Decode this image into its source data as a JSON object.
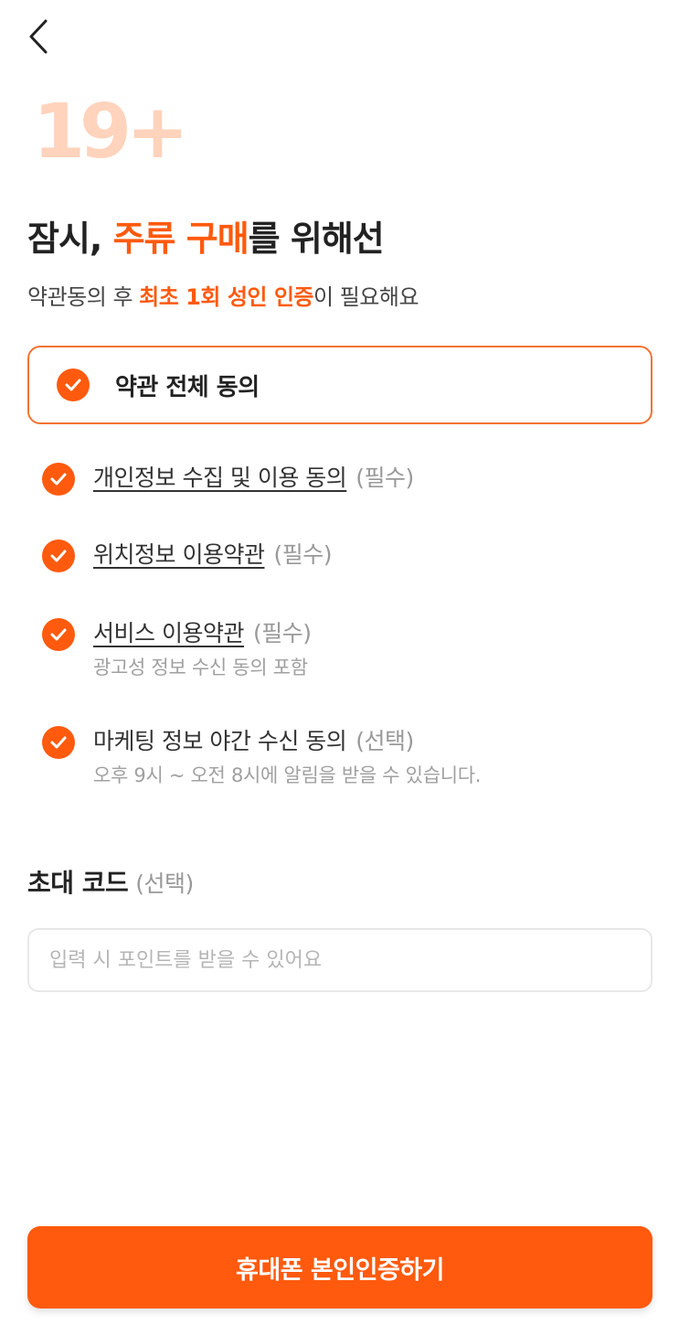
{
  "header": {
    "back_icon": "chevron-left-icon",
    "age_badge": "19+"
  },
  "title": {
    "part1": "잠시, ",
    "accent": "주류 구매",
    "part2": "를 위해선"
  },
  "subtitle": {
    "part1": "약관동의 후 ",
    "accent": "최초 1회 성인 인증",
    "part2": "이 필요해요"
  },
  "agree_all": {
    "label": "약관 전체 동의",
    "checked": true
  },
  "terms": [
    {
      "label": "개인정보 수집 및 이용 동의",
      "tag": "(필수)",
      "desc": "",
      "checked": true
    },
    {
      "label": "위치정보 이용약관",
      "tag": "(필수)",
      "desc": "",
      "checked": true
    },
    {
      "label": "서비스 이용약관",
      "tag": "(필수)",
      "desc": "광고성 정보 수신 동의 포함",
      "checked": true
    },
    {
      "label": "마케팅 정보 야간 수신 동의",
      "tag": "(선택)",
      "desc": "오후 9시 ~ 오전 8시에 알림을 받을 수 있습니다.",
      "checked": true
    }
  ],
  "invite": {
    "title": "초대 코드",
    "tag": "(선택)",
    "value": "",
    "placeholder": "입력 시 포인트를 받을 수 있어요"
  },
  "cta": {
    "label": "휴대폰 본인인증하기"
  },
  "colors": {
    "accent": "#ff5a0e",
    "badge": "#ffd3bc",
    "border_accent": "#f37332"
  }
}
